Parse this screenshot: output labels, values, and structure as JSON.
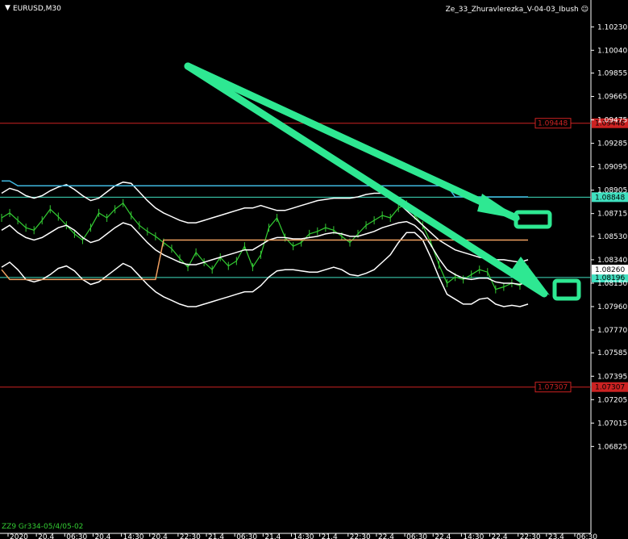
{
  "header": {
    "symbol": "EURUSD,M30",
    "indicator": "Ze_33_Zhuravlerezka_V-04-03_Ibush",
    "smiley_icon": "smiley-icon",
    "arrow_icon": "triangle-down-icon"
  },
  "bottom_left_label": "ZZ9 Gr334-05/4/05-02",
  "chart_data": {
    "type": "line",
    "title": "",
    "xlabel": "",
    "ylabel": "",
    "ylim": [
      1.0612,
      1.1033
    ],
    "y_ticks": [
      "1.10230",
      "1.10040",
      "1.09855",
      "1.09665",
      "1.09475",
      "1.09285",
      "1.09095",
      "1.08905",
      "1.08715",
      "1.08530",
      "1.08340",
      "1.08150",
      "1.07960",
      "1.07770",
      "1.07585",
      "1.07395",
      "1.07205",
      "1.07015",
      "1.06825"
    ],
    "y_tick_values": [
      1.1023,
      1.1004,
      1.09855,
      1.09665,
      1.09475,
      1.09285,
      1.09095,
      1.08905,
      1.08715,
      1.0853,
      1.0834,
      1.0815,
      1.0796,
      1.0777,
      1.07585,
      1.07395,
      1.07205,
      1.07015,
      1.06825
    ],
    "x_ticks": [
      "2020",
      "20.4",
      "06:30",
      "20.4",
      "14:30",
      "20.4",
      "22:30",
      "21.4",
      "06:30",
      "21.4",
      "14:30",
      "21.4",
      "22:30",
      "22.4",
      "06:30",
      "22.4",
      "14:30",
      "22.4",
      "22:30",
      "23.4",
      "06:30"
    ],
    "horizontal_levels": [
      {
        "label": "1.09448",
        "value": 1.09448,
        "color": "#cc2222"
      },
      {
        "label": "1.08848",
        "value": 1.08848,
        "color": "#40e0c0"
      },
      {
        "label": "1.08196",
        "value": 1.08196,
        "color": "#40e0c0"
      },
      {
        "label": "1.07307",
        "value": 1.07307,
        "color": "#cc2222"
      }
    ],
    "current_price": {
      "label": "1.08260",
      "value": 1.0826
    },
    "series": [
      {
        "color": "#33cc33",
        "values": [
          1.0868,
          1.0872,
          1.0866,
          1.086,
          1.0858,
          1.0866,
          1.0875,
          1.0869,
          1.0862,
          1.0855,
          1.085,
          1.086,
          1.0872,
          1.0868,
          1.0875,
          1.088,
          1.087,
          1.0862,
          1.0857,
          1.0853,
          1.0848,
          1.0843,
          1.0835,
          1.0828,
          1.084,
          1.0832,
          1.0826,
          1.0836,
          1.0829,
          1.0833,
          1.0845,
          1.0828,
          1.0838,
          1.086,
          1.0868,
          1.0852,
          1.0845,
          1.0848,
          1.0855,
          1.0857,
          1.086,
          1.0858,
          1.0853,
          1.0848,
          1.0855,
          1.0862,
          1.0866,
          1.087,
          1.0868,
          1.0876,
          1.0879,
          1.087,
          1.0862,
          1.0848,
          1.083,
          1.0815,
          1.082,
          1.0818,
          1.0822,
          1.0826,
          1.0824,
          1.081,
          1.0812,
          1.0815,
          1.0813,
          1.0826
        ]
      },
      {
        "color": "#ffffff",
        "values": [
          1.0858,
          1.0862,
          1.0856,
          1.0852,
          1.085,
          1.0852,
          1.0856,
          1.086,
          1.0862,
          1.0858,
          1.0852,
          1.0848,
          1.085,
          1.0855,
          1.086,
          1.0864,
          1.0862,
          1.0855,
          1.0848,
          1.0842,
          1.0838,
          1.0835,
          1.0832,
          1.083,
          1.083,
          1.0832,
          1.0834,
          1.0836,
          1.0838,
          1.084,
          1.0842,
          1.0842,
          1.0846,
          1.085,
          1.0852,
          1.0852,
          1.0851,
          1.0851,
          1.0852,
          1.0853,
          1.0855,
          1.0856,
          1.0855,
          1.0853,
          1.0853,
          1.0855,
          1.0857,
          1.086,
          1.0862,
          1.0864,
          1.0865,
          1.0862,
          1.0856,
          1.0846,
          1.0835,
          1.0826,
          1.0822,
          1.0819,
          1.0818,
          1.0819,
          1.0819,
          1.0816,
          1.0815,
          1.0815,
          1.0814,
          1.0816
        ]
      },
      {
        "color": "#ffffff",
        "values": [
          1.0888,
          1.0892,
          1.089,
          1.0886,
          1.0884,
          1.0886,
          1.089,
          1.0893,
          1.0895,
          1.0891,
          1.0886,
          1.0882,
          1.0884,
          1.0889,
          1.0894,
          1.0897,
          1.0896,
          1.0889,
          1.0882,
          1.0876,
          1.0872,
          1.0869,
          1.0866,
          1.0864,
          1.0864,
          1.0866,
          1.0868,
          1.087,
          1.0872,
          1.0874,
          1.0876,
          1.0876,
          1.0878,
          1.0876,
          1.0874,
          1.0874,
          1.0876,
          1.0878,
          1.088,
          1.0882,
          1.0883,
          1.0884,
          1.0884,
          1.0884,
          1.0885,
          1.0887,
          1.0888,
          1.0888,
          1.0886,
          1.088,
          1.0874,
          1.0868,
          1.0862,
          1.0856,
          1.085,
          1.0846,
          1.0842,
          1.084,
          1.0838,
          1.0836,
          1.0835,
          1.0834,
          1.0834,
          1.0833,
          1.0832,
          1.0834
        ]
      },
      {
        "color": "#ffffff",
        "values": [
          1.0828,
          1.0832,
          1.0826,
          1.0818,
          1.0816,
          1.0818,
          1.0822,
          1.0827,
          1.0829,
          1.0825,
          1.0818,
          1.0814,
          1.0816,
          1.0821,
          1.0826,
          1.0831,
          1.0828,
          1.0821,
          1.0814,
          1.0808,
          1.0804,
          1.0801,
          1.0798,
          1.0796,
          1.0796,
          1.0798,
          1.08,
          1.0802,
          1.0804,
          1.0806,
          1.0808,
          1.0808,
          1.0813,
          1.082,
          1.0825,
          1.0826,
          1.0826,
          1.0825,
          1.0824,
          1.0824,
          1.0826,
          1.0828,
          1.0826,
          1.0822,
          1.0821,
          1.0823,
          1.0826,
          1.0832,
          1.0838,
          1.0848,
          1.0856,
          1.0856,
          1.085,
          1.0836,
          1.082,
          1.0806,
          1.0802,
          1.0798,
          1.0798,
          1.0802,
          1.0803,
          1.0798,
          1.0796,
          1.0797,
          1.0796,
          1.0798
        ]
      },
      {
        "color": "#40b8e0",
        "values": [
          1.0898,
          1.0898,
          1.0894,
          1.0894,
          1.0894,
          1.0894,
          1.0894,
          1.0894,
          1.0894,
          1.0894,
          1.0894,
          1.0894,
          1.0894,
          1.0894,
          1.0894,
          1.0894,
          1.0894,
          1.0894,
          1.0894,
          1.0894,
          1.0894,
          1.0894,
          1.0894,
          1.0894,
          1.0894,
          1.0894,
          1.0894,
          1.0894,
          1.0894,
          1.0894,
          1.0894,
          1.0894,
          1.0894,
          1.0894,
          1.0894,
          1.0894,
          1.0894,
          1.0894,
          1.0894,
          1.0894,
          1.0894,
          1.0894,
          1.0894,
          1.0894,
          1.0894,
          1.0894,
          1.0894,
          1.0894,
          1.0894,
          1.0894,
          1.0894,
          1.0894,
          1.0894,
          1.0894,
          1.0894,
          1.0894,
          1.0885,
          1.0885,
          1.0885,
          1.0885,
          1.0885,
          1.0885,
          1.0885,
          1.0885,
          1.0885,
          1.0885
        ]
      },
      {
        "color": "#f0a060",
        "values": [
          1.0826,
          1.0818,
          1.0818,
          1.0818,
          1.0818,
          1.0818,
          1.0818,
          1.0818,
          1.0818,
          1.0818,
          1.0818,
          1.0818,
          1.0818,
          1.0818,
          1.0818,
          1.0818,
          1.0818,
          1.0818,
          1.0818,
          1.0818,
          1.085,
          1.085,
          1.085,
          1.085,
          1.085,
          1.085,
          1.085,
          1.085,
          1.085,
          1.085,
          1.085,
          1.085,
          1.085,
          1.085,
          1.085,
          1.085,
          1.085,
          1.085,
          1.085,
          1.085,
          1.085,
          1.085,
          1.085,
          1.085,
          1.085,
          1.085,
          1.085,
          1.085,
          1.085,
          1.085,
          1.085,
          1.085,
          1.085,
          1.085,
          1.085,
          1.085,
          1.085,
          1.085,
          1.085,
          1.085,
          1.085,
          1.085,
          1.085,
          1.085,
          1.085,
          1.085
        ]
      }
    ],
    "grid": false,
    "legend": "none"
  }
}
